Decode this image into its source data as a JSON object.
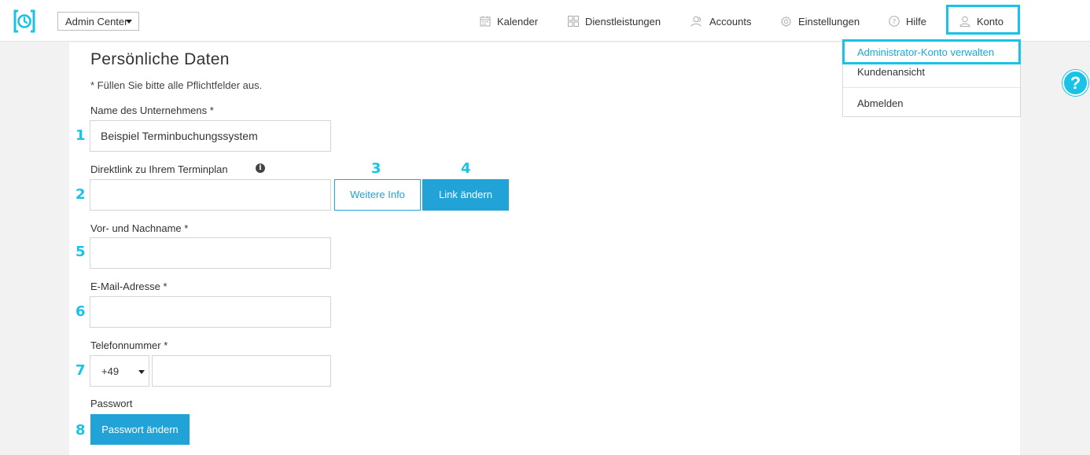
{
  "header": {
    "org_select": "Admin Center",
    "nav": [
      {
        "label": "Kalender",
        "icon": "calendar-icon"
      },
      {
        "label": "Dienstleistungen",
        "icon": "grid-icon"
      },
      {
        "label": "Accounts",
        "icon": "users-icon"
      },
      {
        "label": "Einstellungen",
        "icon": "gear-icon"
      },
      {
        "label": "Hilfe",
        "icon": "question-icon"
      },
      {
        "label": "Konto",
        "icon": "user-icon"
      }
    ]
  },
  "account_menu": {
    "items": [
      "Administrator-Konto verwalten",
      "Kundenansicht",
      "Abmelden"
    ]
  },
  "form": {
    "title": "Persönliche Daten",
    "required_hint": "* Füllen Sie bitte alle Pflichtfelder aus.",
    "company_label": "Name des Unternehmens *",
    "company_value": "Beispiel Terminbuchungssystem",
    "link_label": "Direktlink zu Ihrem Terminplan",
    "link_value": "",
    "more_info_button": "Weitere Info",
    "change_link_button": "Link ändern",
    "name_label": "Vor- und Nachname *",
    "email_label": "E-Mail-Adresse *",
    "phone_label": "Telefonnummer *",
    "phone_code": "+49",
    "password_label": "Passwort",
    "change_password_button": "Passwort ändern"
  },
  "markers": [
    "1",
    "2",
    "3",
    "4",
    "5",
    "6",
    "7",
    "8"
  ],
  "colors": {
    "accent": "#17c3e6",
    "primary_button": "#22a3d8"
  }
}
